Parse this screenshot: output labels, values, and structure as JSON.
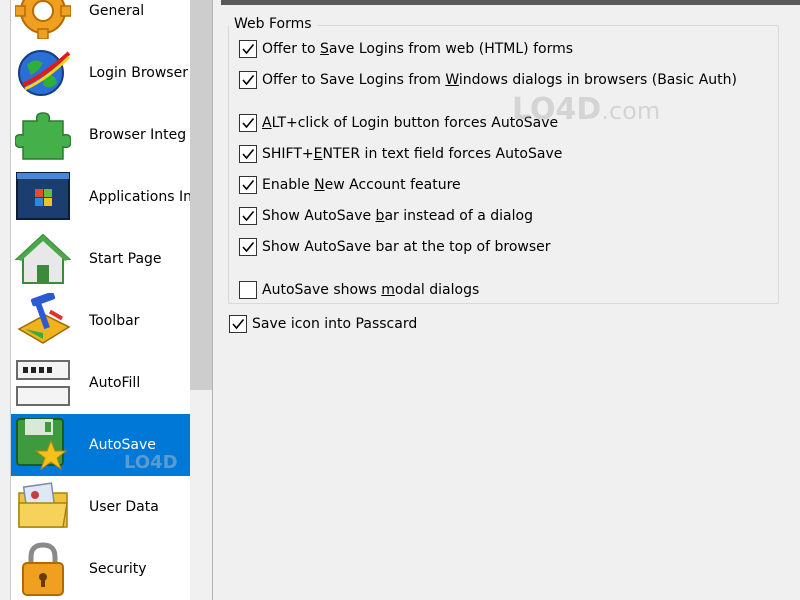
{
  "sidebar": {
    "items": [
      {
        "label": "General",
        "icon": "gear-icon"
      },
      {
        "label": "Login Browser",
        "icon": "globe-icon"
      },
      {
        "label": "Browser Integ",
        "icon": "puzzle-icon"
      },
      {
        "label": "Applications In",
        "icon": "application-window-icon"
      },
      {
        "label": "Start Page",
        "icon": "house-icon"
      },
      {
        "label": "Toolbar",
        "icon": "toolbox-icon"
      },
      {
        "label": "AutoFill",
        "icon": "password-fields-icon"
      },
      {
        "label": "AutoSave",
        "icon": "floppy-star-icon",
        "selected": true
      },
      {
        "label": "User Data",
        "icon": "photo-folder-icon"
      },
      {
        "label": "Security",
        "icon": "padlock-icon"
      }
    ]
  },
  "web_forms": {
    "title": "Web Forms",
    "options": [
      {
        "pre": "Offer to ",
        "key": "S",
        "post": "ave Logins from web (HTML) forms",
        "checked": true
      },
      {
        "pre": "Offer to Save Logins from ",
        "key": "W",
        "post": "indows dialogs in browsers (Basic Auth)",
        "checked": true
      },
      {
        "pre": "",
        "key": "A",
        "post": "LT+click of Login button forces AutoSave",
        "checked": true
      },
      {
        "pre": "SHIFT+",
        "key": "E",
        "post": "NTER in text field forces AutoSave",
        "checked": true
      },
      {
        "pre": "Enable ",
        "key": "N",
        "post": "ew Account feature",
        "checked": true
      },
      {
        "pre": "Show AutoSave ",
        "key": "b",
        "post": "ar instead of a dialog",
        "checked": true
      },
      {
        "pre": "Show AutoSave bar at the top of browser",
        "key": "",
        "post": "",
        "checked": true
      },
      {
        "pre": "AutoSave shows ",
        "key": "m",
        "post": "odal dialogs",
        "checked": false
      }
    ]
  },
  "save_icon_option": {
    "label": "Save icon into Passcard",
    "checked": true
  },
  "watermark": {
    "brand": "LO4D",
    "suffix": ".com"
  },
  "colors": {
    "selection": "#0078d7",
    "window_bg": "#f0f0f0",
    "sidebar_bg": "#ffffff"
  }
}
